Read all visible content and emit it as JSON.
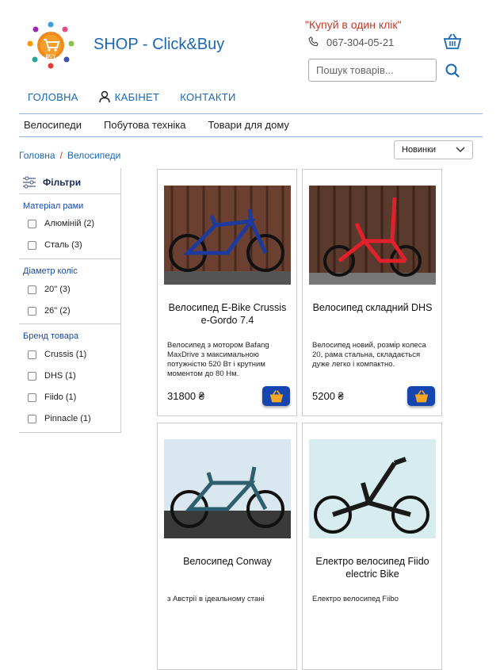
{
  "header": {
    "logo_text": "BUY",
    "brand": "SHOP - Click&Buy",
    "promo": "\"Купуй в один клік\"",
    "phone": "067-304-05-21",
    "search_placeholder": "Пошук товарів..."
  },
  "nav": {
    "home": "ГОЛОВНА",
    "cabinet": "КАБІНЕТ",
    "contacts": "КОНТАКТИ"
  },
  "categories": [
    "Велосипеди",
    "Побутова техніка",
    "Товари для дому"
  ],
  "breadcrumb": {
    "home": "Головна",
    "sep": "/",
    "current": "Велосипеди"
  },
  "sort": {
    "selected": "Новинки"
  },
  "filters": {
    "title": "Фільтри",
    "sections": [
      {
        "title": "Матеріал рами",
        "options": [
          "Алюміній (2)",
          "Сталь (3)"
        ]
      },
      {
        "title": "Діаметр коліс",
        "options": [
          "20\" (3)",
          "26\" (2)"
        ]
      },
      {
        "title": "Бренд товара",
        "options": [
          "Crussis (1)",
          "DHS (1)",
          "Fiido (1)",
          "Pinnacle (1)"
        ]
      }
    ]
  },
  "products": [
    {
      "name": "Велосипед E-Bike Crussis e-Gordo 7.4",
      "desc": "Велосипед з мотором Bafang MaxDrive з максимальною потужністю 520 Вт і крутним моментом до 80 Нм.",
      "price": "31800 ₴",
      "frame_color": "#1d3a9c"
    },
    {
      "name": "Велосипед складний DHS",
      "desc": "Велосипед новий, розмір колеса 20, рама стальна, складається дуже легко і компактно.",
      "price": "5200 ₴",
      "frame_color": "#e0202a"
    },
    {
      "name": "Велосипед Conway",
      "desc": "з Австрії в ідеальному стані",
      "price": "",
      "frame_color": "#2f5f6e"
    },
    {
      "name": "Електро велосипед Fiido electric Bike",
      "desc": "Електро велосипед Fiibo",
      "price": "",
      "frame_color": "#1a1a1a"
    }
  ],
  "colors": {
    "accent": "#1a67b8",
    "promo": "#c0392b",
    "button": "#1546b0",
    "cart_icon": "#f5a623"
  }
}
